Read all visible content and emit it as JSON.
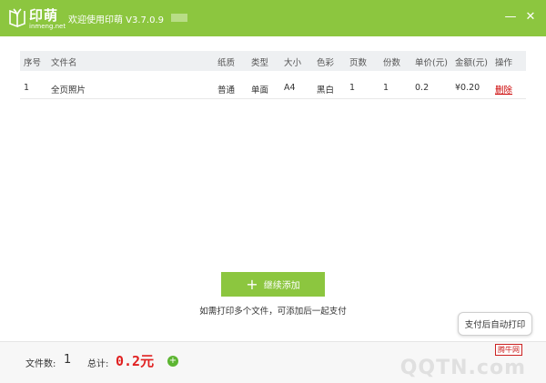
{
  "app": {
    "logo_text": "印萌",
    "logo_sub": "inmeng.net",
    "title": "欢迎使用印萌 V3.7.0.9",
    "minimize_glyph": "—",
    "close_glyph": "✕"
  },
  "table": {
    "headers": [
      "序号",
      "文件名",
      "纸质",
      "类型",
      "大小",
      "色彩",
      "页数",
      "份数",
      "单价(元)",
      "金额(元)",
      "操作"
    ],
    "rows": [
      {
        "index": "1",
        "filename": "全页照片",
        "paper": "普通",
        "type": "单面",
        "size": "A4",
        "color": "黑白",
        "pages": "1",
        "copies": "1",
        "unit_price": "0.2",
        "amount": "¥0.20",
        "action": "删除"
      }
    ]
  },
  "add_more": {
    "label": "继续添加",
    "hint": "如需打印多个文件，可添加后一起支付"
  },
  "auto_print_tip": "支付后自动打印",
  "footer": {
    "file_count_label": "文件数:",
    "file_count": "1",
    "total_label": "总计:",
    "total_value": "0.2元"
  },
  "watermark": {
    "badge": "腾牛网",
    "text": "QQTN.com"
  },
  "colors": {
    "accent": "#8cc63f",
    "total": "#e02020",
    "delete": "#cc0000"
  }
}
